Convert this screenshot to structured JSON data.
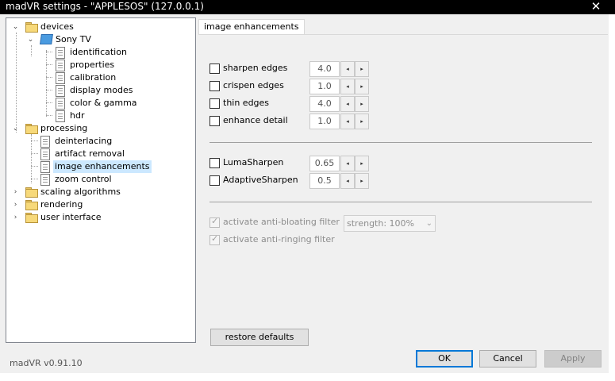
{
  "window": {
    "title": "madVR settings - \"APPLESOS\" (127.0.0.1)",
    "close_glyph": "✕"
  },
  "tree": {
    "devices": "devices",
    "sony_tv": "Sony TV",
    "identification": "identification",
    "properties": "properties",
    "calibration": "calibration",
    "display_modes": "display modes",
    "color_gamma": "color & gamma",
    "hdr": "hdr",
    "processing": "processing",
    "deinterlacing": "deinterlacing",
    "artifact_removal": "artifact removal",
    "image_enhancements": "image enhancements",
    "zoom_control": "zoom control",
    "scaling_algorithms": "scaling algorithms",
    "rendering": "rendering",
    "user_interface": "user interface",
    "expanded_glyph": "⌄",
    "collapsed_glyph": "›"
  },
  "tab": {
    "label": "image enhancements"
  },
  "options": {
    "sharpen_edges": {
      "label": "sharpen edges",
      "value": "4.0",
      "checked": false
    },
    "crispen_edges": {
      "label": "crispen edges",
      "value": "1.0",
      "checked": false
    },
    "thin_edges": {
      "label": "thin edges",
      "value": "4.0",
      "checked": false
    },
    "enhance_detail": {
      "label": "enhance detail",
      "value": "1.0",
      "checked": false
    },
    "luma_sharpen": {
      "label": "LumaSharpen",
      "value": "0.65",
      "checked": false
    },
    "adaptive_sharpen": {
      "label": "AdaptiveSharpen",
      "value": "0.5",
      "checked": false
    },
    "anti_bloating": {
      "label": "activate anti-bloating filter",
      "checked": true,
      "disabled": true
    },
    "anti_ringing": {
      "label": "activate anti-ringing filter",
      "checked": true,
      "disabled": true
    }
  },
  "spin": {
    "left": "◂",
    "right": "▸"
  },
  "strength": {
    "value": "strength: 100%",
    "arrow": "⌄"
  },
  "buttons": {
    "restore_defaults": "restore defaults",
    "ok": "OK",
    "cancel": "Cancel",
    "apply": "Apply"
  },
  "footer": {
    "version": "madVR v0.91.10"
  }
}
